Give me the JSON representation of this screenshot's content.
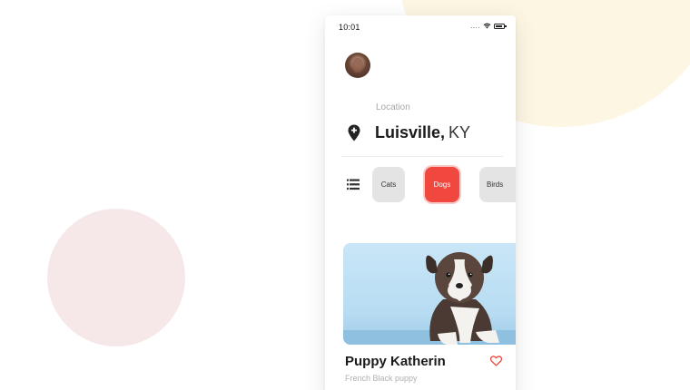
{
  "status_bar": {
    "time": "10:01",
    "signal": "....",
    "icons": [
      "wifi-icon",
      "battery-icon"
    ]
  },
  "location": {
    "label": "Location",
    "city": "Luisville,",
    "state": "KY",
    "icon": "map-pin-icon"
  },
  "categories": {
    "menu_icon": "list-icon",
    "items": [
      {
        "label": "Cats",
        "selected": false
      },
      {
        "label": "Dogs",
        "selected": true
      },
      {
        "label": "Birds",
        "selected": false
      }
    ]
  },
  "pet_card": {
    "name": "Puppy Katherin",
    "breed": "French Black puppy",
    "favorite_icon": "heart-outline-icon"
  },
  "colors": {
    "accent": "#f0483e",
    "chip_bg": "#e4e4e4",
    "bg_circle_yellow": "#fdf6e3",
    "bg_circle_pink": "#f6e8e8"
  }
}
